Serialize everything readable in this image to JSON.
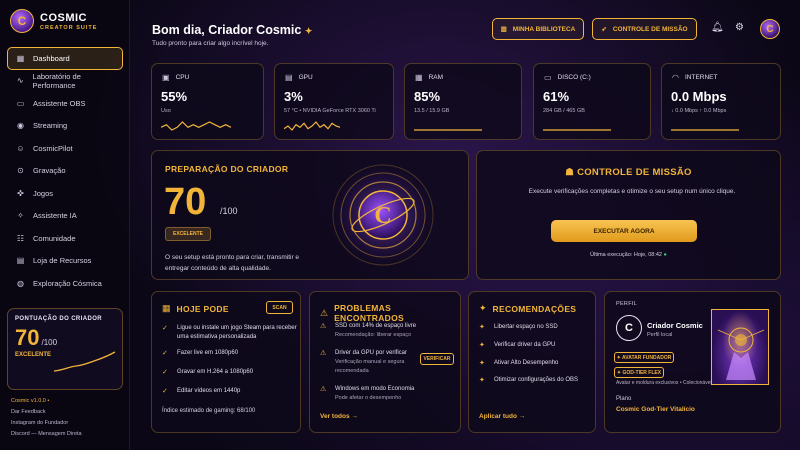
{
  "colors": {
    "accent": "#f2b53a",
    "background": "#0b0716",
    "success": "#39d37a"
  },
  "brand": {
    "name": "COSMIC",
    "subtitle": "CREATOR SUITE",
    "logo_letter": "C"
  },
  "sidebar": {
    "items": [
      {
        "label": "Dashboard",
        "icon": "grid-icon",
        "active": true
      },
      {
        "label": "Laboratório de Performance",
        "icon": "pulse-icon"
      },
      {
        "label": "Assistente OBS",
        "icon": "monitor-icon"
      },
      {
        "label": "Streaming",
        "icon": "broadcast-icon"
      },
      {
        "label": "CosmicPilot",
        "icon": "copilot-icon"
      },
      {
        "label": "Gravação",
        "icon": "record-icon"
      },
      {
        "label": "Jogos",
        "icon": "gamepad-icon"
      },
      {
        "label": "Assistente IA",
        "icon": "sparkle-icon"
      },
      {
        "label": "Comunidade",
        "icon": "users-icon"
      },
      {
        "label": "Loja de Recursos",
        "icon": "store-icon"
      },
      {
        "label": "Exploração Cósmica",
        "icon": "planet-icon"
      }
    ],
    "score": {
      "label": "PONTUAÇÃO DO CRIADOR",
      "value": "70",
      "max": "/100",
      "rating": "EXCELENTE"
    },
    "footer": {
      "version": "Cosmic v1.0.0 •",
      "links": [
        "Dar Feedback",
        "Instagram do Fundador",
        "Discord — Mensagem Direta"
      ]
    }
  },
  "header": {
    "greeting": "Bom dia, Criador Cosmic",
    "greeting_mark": "✦",
    "subtitle": "Tudo pronto para criar algo incrível hoje.",
    "library_button": "MINHA BIBLIOTECA",
    "mission_button": "CONTROLE DE MISSÃO",
    "avatar_letter": "C"
  },
  "stats": [
    {
      "label": "CPU",
      "icon": "cpu-icon",
      "value": "55%",
      "sub": "Uso",
      "trend": [
        5,
        6,
        4,
        5,
        7,
        5,
        6,
        5,
        6,
        7,
        6,
        5,
        6,
        5
      ]
    },
    {
      "label": "GPU",
      "icon": "gpu-icon",
      "value": "3%",
      "sub": "57 °C • NVIDIA GeForce RTX 3060 Ti",
      "trend": [
        3,
        5,
        2,
        6,
        4,
        7,
        3,
        5,
        8,
        4,
        6,
        3,
        7,
        5,
        4
      ]
    },
    {
      "label": "RAM",
      "icon": "memory-icon",
      "value": "85%",
      "sub": "13.5 / 15.9 GB",
      "trend": [
        5,
        5,
        5,
        5,
        5,
        5,
        5,
        5,
        5,
        5
      ]
    },
    {
      "label": "DISCO (C:)",
      "icon": "disk-icon",
      "value": "61%",
      "sub": "284 GB / 465 GB",
      "trend": [
        5,
        5,
        5,
        5,
        5,
        5,
        5,
        5,
        5,
        5
      ]
    },
    {
      "label": "INTERNET",
      "icon": "wifi-icon",
      "value": "0.0 Mbps",
      "sub": "↓ 0.0 Mbps  ↑ 0.0 Mbps",
      "trend": [
        5,
        5,
        5,
        5,
        5,
        5,
        5,
        5,
        5,
        5
      ]
    }
  ],
  "preparation": {
    "title": "PREPARAÇÃO DO CRIADOR",
    "value": "70",
    "max": "/100",
    "rating": "EXCELENTE",
    "description": "O seu setup está pronto para criar, transmitir e entregar conteúdo de alta qualidade."
  },
  "mission": {
    "title": "CONTROLE DE MISSÃO",
    "description": "Execute verificações completas e otimize o seu setup num único clique.",
    "button": "EXECUTAR AGORA",
    "last_run": "Última execução: Hoje, 08:42"
  },
  "today": {
    "title": "HOJE PODE",
    "scan_button": "SCAN",
    "items": [
      "Ligue ou instale um jogo Steam para receber uma estimativa personalizada",
      "Fazer live em 1080p60",
      "Gravar em H.264 a 1080p60",
      "Editar vídeos em 1440p"
    ],
    "footer": "Índice estimado de gaming: 68/100"
  },
  "problems": {
    "title": "PROBLEMAS ENCONTRADOS",
    "items": [
      {
        "title": "SSD com 14% de espaço livre",
        "detail": "Recomendação: liberar espaço"
      },
      {
        "title": "Driver da GPU por verificar",
        "detail": "Verificação manual e segura recomendada",
        "action": "VERIFICAR"
      },
      {
        "title": "Windows em modo Economia",
        "detail": "Pode afetar o desempenho"
      }
    ],
    "link": "Ver todos →"
  },
  "recommendations": {
    "title": "RECOMENDAÇÕES",
    "items": [
      "Libertar espaço no SSD",
      "Verificar driver da GPU",
      "Ativar Alto Desempenho",
      "Otimizar configurações do OBS"
    ],
    "link": "Aplicar tudo →"
  },
  "profile": {
    "label": "PERFIL",
    "avatar_letter": "C",
    "name": "Criador Cosmic",
    "location": "Perfil local",
    "badges": [
      "✦ AVATAR FUNDADOR",
      "✦ GOD-TIER FLEX"
    ],
    "caption": "Avatar e moldura exclusivos • Colecionável",
    "plan_label": "Plano",
    "plan_value": "Cosmic God-Tier Vitalício"
  }
}
